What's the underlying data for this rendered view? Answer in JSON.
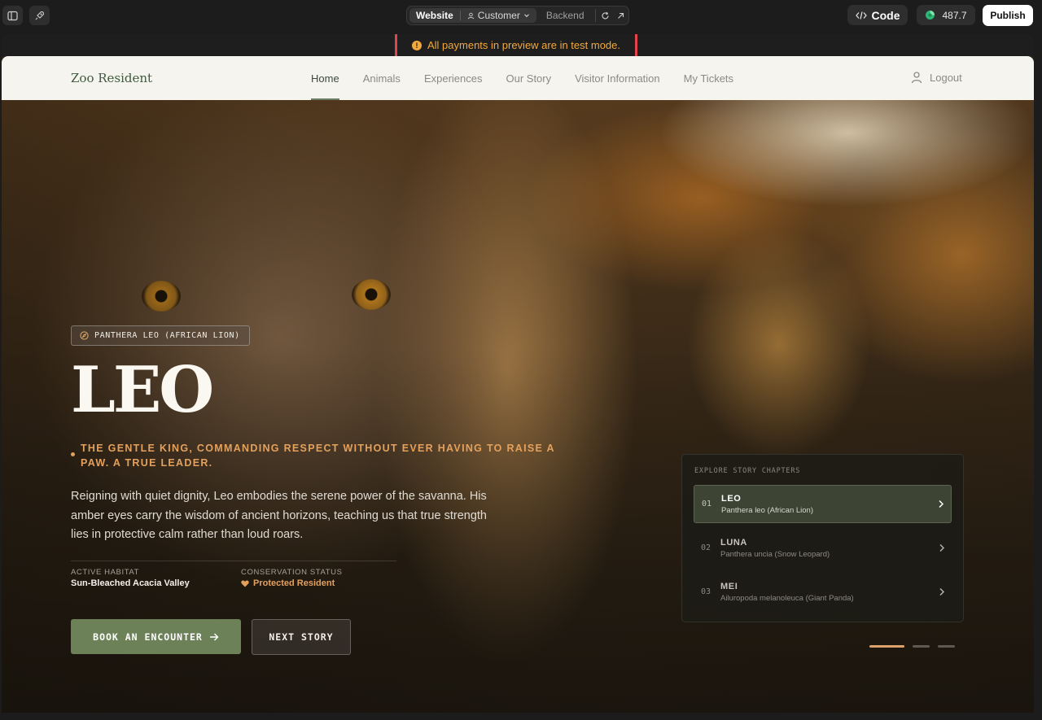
{
  "editor": {
    "tabs": {
      "website": "Website",
      "customer": "Customer",
      "backend": "Backend"
    },
    "code_label": "Code",
    "credits": "487.7",
    "publish_label": "Publish"
  },
  "preview": {
    "test_banner": "All payments in preview are in test mode."
  },
  "site": {
    "brand": "Zoo Resident",
    "nav": [
      "Home",
      "Animals",
      "Experiences",
      "Our Story",
      "Visitor Information",
      "My Tickets"
    ],
    "active_nav": "Home",
    "logout": "Logout"
  },
  "hero": {
    "species": "PANTHERA LEO (AFRICAN LION)",
    "title": "LEO",
    "tagline": "THE GENTLE KING, COMMANDING RESPECT WITHOUT EVER HAVING TO RAISE A PAW. A TRUE LEADER.",
    "description": "Reigning with quiet dignity, Leo embodies the serene power of the savanna. His amber eyes carry the wisdom of ancient horizons, teaching us that true strength lies in protective calm rather than loud roars.",
    "habitat_label": "ACTIVE HABITAT",
    "habitat_value": "Sun-Bleached Acacia Valley",
    "status_label": "CONSERVATION STATUS",
    "status_value": "Protected Resident",
    "book_label": "BOOK AN ENCOUNTER",
    "next_label": "NEXT STORY"
  },
  "chapters": {
    "title": "EXPLORE STORY CHAPTERS",
    "items": [
      {
        "num": "01",
        "name": "LEO",
        "sub": "Panthera leo (African Lion)"
      },
      {
        "num": "02",
        "name": "LUNA",
        "sub": "Panthera uncia (Snow Leopard)"
      },
      {
        "num": "03",
        "name": "MEI",
        "sub": "Ailuropoda melanoleuca (Giant Panda)"
      }
    ],
    "active_index": 0
  },
  "colors": {
    "accent_green": "#6c8158",
    "accent_amber": "#e4a15d",
    "warning": "#f2a93b",
    "highlight_box": "#e3434b"
  },
  "icons": [
    "panel-toggle-icon",
    "rocket-icon",
    "user-icon",
    "chevron-down-icon",
    "refresh-icon",
    "external-link-icon",
    "code-icon",
    "credits-icon",
    "warning-icon",
    "person-icon",
    "compass-icon",
    "heart-icon",
    "arrow-right-icon",
    "chevron-right-icon"
  ]
}
